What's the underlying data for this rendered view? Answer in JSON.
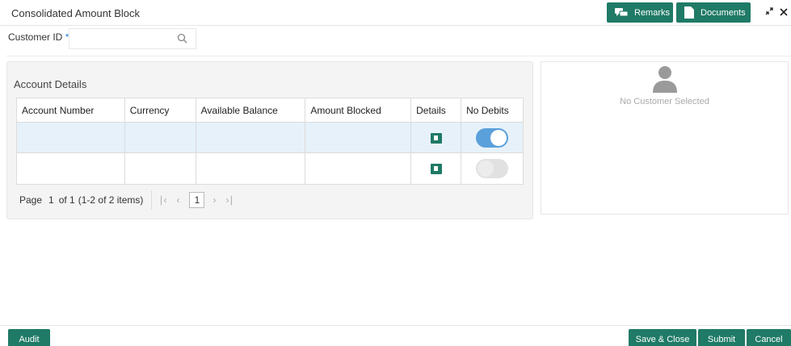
{
  "header": {
    "title": "Consolidated Amount Block",
    "remarks_label": "Remarks",
    "documents_label": "Documents"
  },
  "customer": {
    "label": "Customer ID",
    "required_mark": "*",
    "value": "",
    "placeholder": ""
  },
  "account_details": {
    "title": "Account Details",
    "columns": [
      "Account Number",
      "Currency",
      "Available Balance",
      "Amount Blocked",
      "Details",
      "No Debits"
    ],
    "rows": [
      {
        "account_number": "",
        "currency": "",
        "available_balance": "",
        "amount_blocked": "",
        "no_debits": true,
        "selected": true
      },
      {
        "account_number": "",
        "currency": "",
        "available_balance": "",
        "amount_blocked": "",
        "no_debits": false,
        "selected": false
      }
    ]
  },
  "pagination": {
    "page_label": "Page",
    "page": "1",
    "of_label": "of 1",
    "items_label": "(1-2 of 2 items)",
    "current": "1"
  },
  "side_panel": {
    "no_customer": "No Customer Selected"
  },
  "footer": {
    "audit_label": "Audit",
    "save_close_label": "Save & Close",
    "submit_label": "Submit",
    "cancel_label": "Cancel"
  },
  "colors": {
    "primary": "#1f7a66",
    "toggle_on": "#5aa0db",
    "selected_row": "#e6f1fa"
  }
}
